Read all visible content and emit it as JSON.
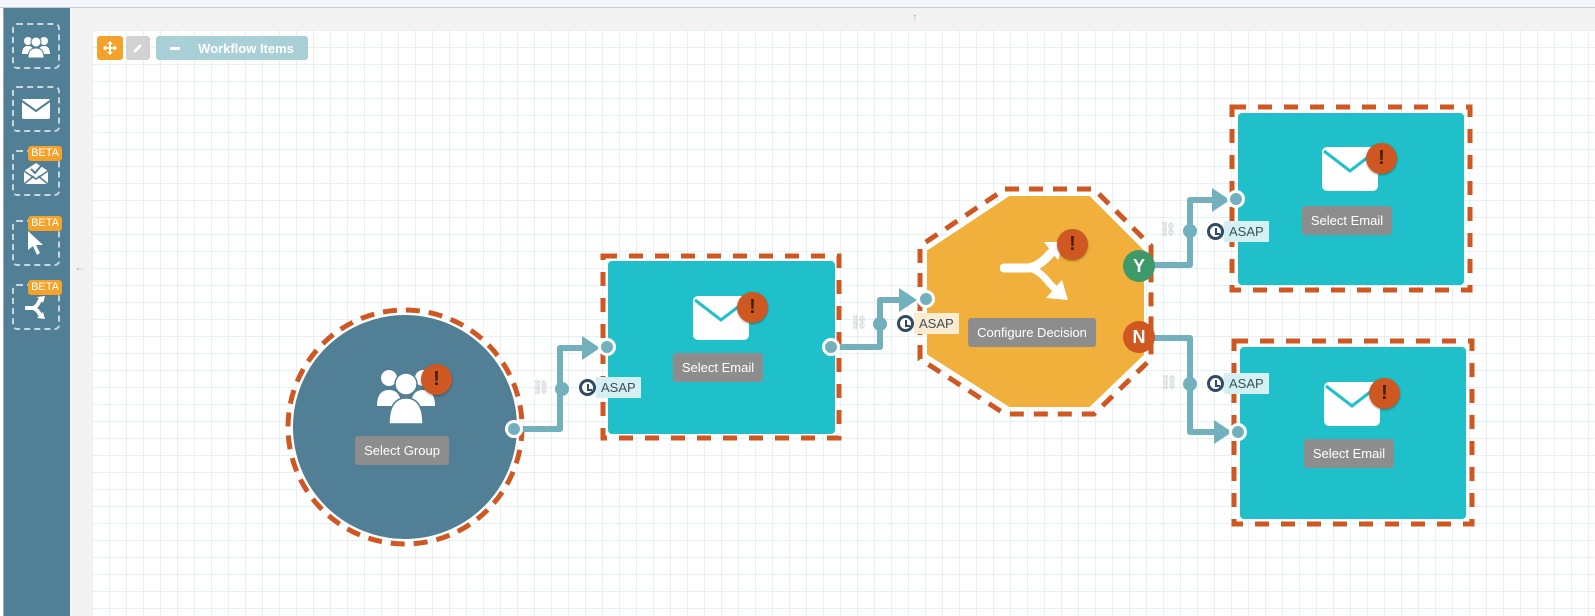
{
  "toolbar": {
    "move_icon": "move-icon",
    "edit_icon": "pencil-icon",
    "workflow_items_label": "Workflow Items"
  },
  "sidebar": {
    "items": [
      {
        "icon": "group-icon",
        "beta": false
      },
      {
        "icon": "email-icon",
        "beta": false
      },
      {
        "icon": "email-check-icon",
        "beta": true,
        "badge": "BETA"
      },
      {
        "icon": "pointer-icon",
        "beta": true,
        "badge": "BETA"
      },
      {
        "icon": "split-icon",
        "beta": true,
        "badge": "BETA"
      }
    ]
  },
  "nodes": {
    "group": {
      "label": "Select Group",
      "warning": "!"
    },
    "email1": {
      "label": "Select Email",
      "warning": "!"
    },
    "decision": {
      "label": "Configure Decision",
      "warning": "!",
      "yes": "Y",
      "no": "N"
    },
    "email_yes": {
      "label": "Select Email",
      "warning": "!"
    },
    "email_no": {
      "label": "Select Email",
      "warning": "!"
    }
  },
  "connections": {
    "timing": "ASAP"
  },
  "colors": {
    "sidebar": "#517f95",
    "email_node": "#1fc0c9",
    "group_node": "#517f95",
    "decision_node": "#f1b03b",
    "warning": "#cf5722",
    "yes": "#3d9a68",
    "no": "#cf5722",
    "connector": "#72b0bd"
  }
}
